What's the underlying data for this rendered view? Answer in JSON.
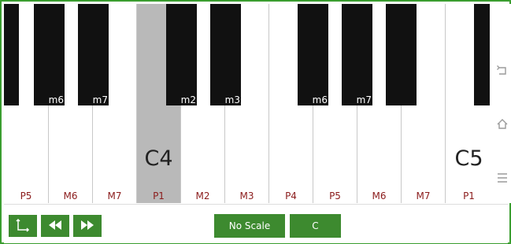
{
  "keyboard": {
    "white_keys": [
      {
        "interval": "P5",
        "note": ""
      },
      {
        "interval": "M6",
        "note": ""
      },
      {
        "interval": "M7",
        "note": ""
      },
      {
        "interval": "P1",
        "note": "C4",
        "highlighted": true
      },
      {
        "interval": "M2",
        "note": ""
      },
      {
        "interval": "M3",
        "note": ""
      },
      {
        "interval": "P4",
        "note": ""
      },
      {
        "interval": "P5",
        "note": ""
      },
      {
        "interval": "M6",
        "note": ""
      },
      {
        "interval": "M7",
        "note": ""
      },
      {
        "interval": "P1",
        "note": "C5"
      }
    ],
    "black_keys": [
      {
        "interval": ""
      },
      {
        "interval": "m6"
      },
      {
        "interval": "m7"
      },
      {
        "interval": "m2"
      },
      {
        "interval": "m3"
      },
      {
        "interval": "m6"
      },
      {
        "interval": "m7"
      },
      {
        "interval": ""
      }
    ]
  },
  "sidebar": {
    "icons": [
      "back-icon",
      "home-icon",
      "menu-icon"
    ]
  },
  "controls": {
    "scale_button_label": "No Scale",
    "key_button_label": "C",
    "icons": [
      "axis-toggle-icon",
      "rewind-icon",
      "fast-forward-icon"
    ]
  },
  "colors": {
    "accent_green": "#3d8a2f",
    "interval_label": "#8b1c1c",
    "highlight_key": "#b9b9b9",
    "black_key": "#111111"
  }
}
